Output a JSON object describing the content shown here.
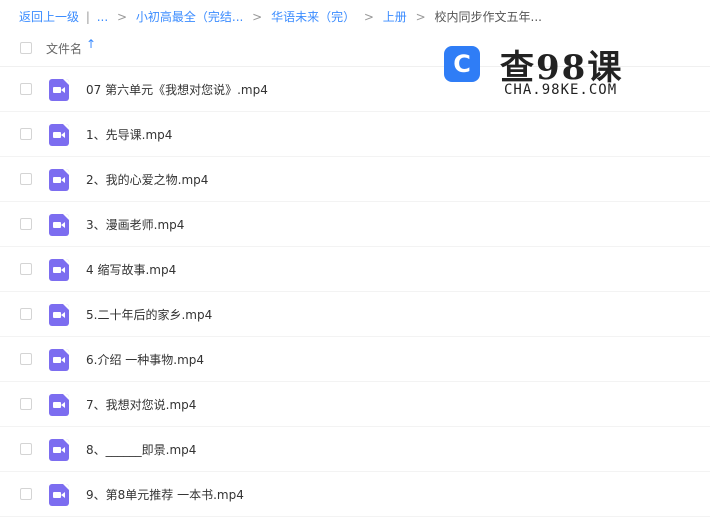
{
  "breadcrumb": {
    "back": "返回上一级",
    "ellipsis": "...",
    "sep1": "|",
    "sep": ">",
    "items": [
      "小初高最全（完结...",
      "华语未来（完）",
      "上册"
    ],
    "current": "校内同步作文五年..."
  },
  "header": {
    "column_name": "文件名",
    "sort_icon": "↑"
  },
  "files": [
    "07 第六单元《我想对您说》.mp4",
    "1、先导课.mp4",
    "2、我的心爱之物.mp4",
    "3、漫画老师.mp4",
    "4 缩写故事.mp4",
    "5.二十年后的家乡.mp4",
    "6.介绍 一种事物.mp4",
    "7、我想对您说.mp4",
    "8、______即景.mp4",
    "9、第8单元推荐 一本书.mp4"
  ],
  "watermark": {
    "icon_glyph": "C",
    "title": "查98课",
    "subtitle": "CHA.98KE.COM"
  },
  "colors": {
    "link": "#3b8cff",
    "video_icon": "#7c6df0",
    "logo_icon": "#2f7df6"
  }
}
